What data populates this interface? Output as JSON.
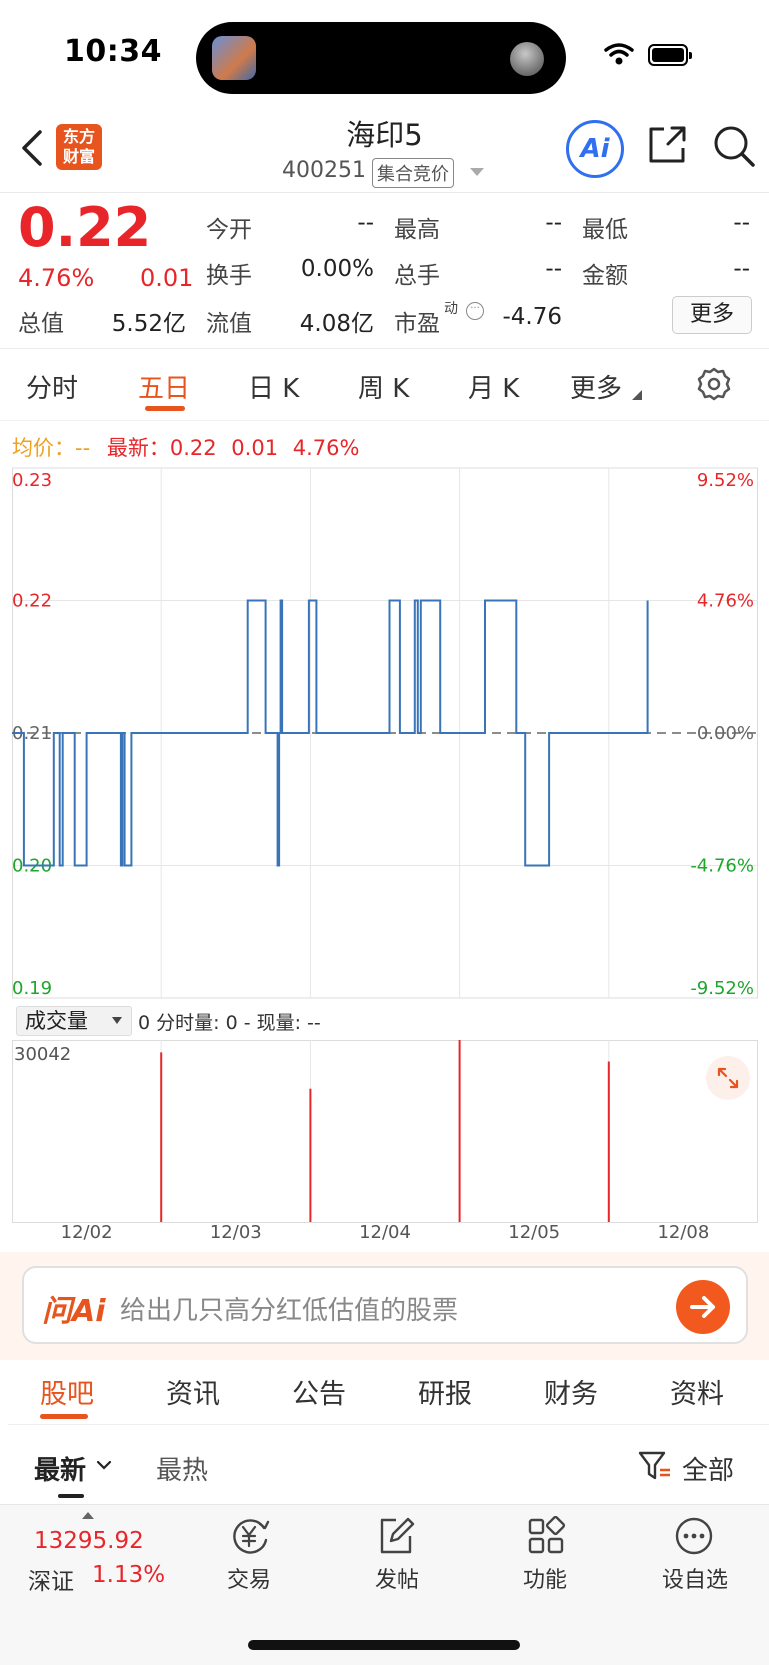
{
  "status_bar": {
    "time": "10:34"
  },
  "header": {
    "logo_text_1": "东方",
    "logo_text_2": "财富",
    "stock_name": "海印5",
    "stock_code": "400251",
    "session_badge": "集合竞价",
    "ai_label": "Ai"
  },
  "quote": {
    "price": "0.22",
    "change_pct": "4.76%",
    "change": "0.01",
    "fields": {
      "open_label": "今开",
      "open_value": "--",
      "high_label": "最高",
      "high_value": "--",
      "low_label": "最低",
      "low_value": "--",
      "turnover_label": "换手",
      "turnover_value": "0.00%",
      "volume_label": "总手",
      "volume_value": "--",
      "amount_label": "金额",
      "amount_value": "--",
      "total_cap_label": "总值",
      "total_cap_value": "5.52亿",
      "float_cap_label": "流值",
      "float_cap_value": "4.08亿",
      "pe_label": "市盈",
      "pe_sup": "动",
      "pe_value": "-4.76"
    },
    "more_button": "更多"
  },
  "tabs": [
    "分时",
    "五日",
    "日 K",
    "周 K",
    "月 K",
    "更多"
  ],
  "active_tab": "五日",
  "legend": {
    "avg_label": "均价：",
    "avg_value": "--",
    "latest_label": "最新：",
    "latest_price": "0.22",
    "latest_change": "0.01",
    "latest_pct": "4.76%"
  },
  "chart_data": [
    {
      "type": "line",
      "title": "",
      "x_categories": [
        "12/02",
        "12/03",
        "12/04",
        "12/05",
        "12/08"
      ],
      "y_ticks": [
        "0.23",
        "0.22",
        "0.21",
        "0.20",
        "0.19"
      ],
      "y_right_ticks": [
        "9.52%",
        "4.76%",
        "0.00%",
        "-4.76%",
        "-9.52%"
      ],
      "ylim": [
        0.19,
        0.23
      ],
      "reference_line": 0.21,
      "series": [
        {
          "x": [
            0.0,
            0.08,
            0.08,
            0.28,
            0.28,
            0.32,
            0.32,
            0.34,
            0.34,
            0.345,
            0.345,
            0.42,
            0.42,
            0.5,
            0.5,
            0.73,
            0.73,
            0.74,
            0.74,
            0.755,
            0.755,
            0.8,
            0.8,
            1.0,
            1.0,
            1.07,
            1.07,
            1.27,
            1.27,
            1.29,
            1.29,
            1.3,
            1.3,
            1.31,
            1.31,
            1.35,
            1.35,
            1.58,
            1.58,
            1.7,
            1.7,
            1.78,
            1.78,
            1.79,
            1.79,
            1.8,
            1.8,
            1.81,
            1.81,
            1.99,
            1.99,
            2.04,
            2.04,
            2.53,
            2.53,
            2.6,
            2.6,
            2.7,
            2.7,
            2.72,
            2.72,
            2.74,
            2.74,
            2.87,
            2.87,
            3.17,
            3.17,
            3.38,
            3.38,
            3.44,
            3.44,
            3.6,
            3.6,
            3.67,
            3.67,
            3.86,
            3.86,
            4.0,
            4.0,
            4.26,
            4.26
          ],
          "y": [
            0.21,
            0.21,
            0.2,
            0.2,
            0.21,
            0.21,
            0.2,
            0.2,
            0.21,
            0.21,
            0.21,
            0.21,
            0.2,
            0.2,
            0.21,
            0.21,
            0.2,
            0.2,
            0.21,
            0.21,
            0.2,
            0.2,
            0.21,
            0.21,
            0.21,
            0.21,
            0.21,
            0.21,
            0.21,
            0.21,
            0.21,
            0.21,
            0.21,
            0.21,
            0.21,
            0.21,
            0.21,
            0.21,
            0.22,
            0.22,
            0.21,
            0.21,
            0.2,
            0.2,
            0.21,
            0.21,
            0.22,
            0.22,
            0.21,
            0.21,
            0.22,
            0.22,
            0.21,
            0.21,
            0.22,
            0.22,
            0.21,
            0.21,
            0.22,
            0.22,
            0.21,
            0.21,
            0.22,
            0.22,
            0.21,
            0.21,
            0.22,
            0.22,
            0.21,
            0.21,
            0.2,
            0.2,
            0.21,
            0.21,
            0.21,
            0.21,
            0.21,
            0.21,
            0.21,
            0.21,
            0.22
          ]
        }
      ]
    },
    {
      "type": "bar",
      "title": "",
      "ymax_label": "30042",
      "ylim": [
        0,
        30042
      ],
      "x": [
        1.0,
        2.0,
        3.0,
        4.0
      ],
      "values": [
        28000,
        22000,
        30042,
        26500
      ]
    }
  ],
  "volume_panel": {
    "selector_label": "成交量",
    "info": "0 分时量: 0 - 现量: --"
  },
  "ask_ai": {
    "logo": "问Ai",
    "prompt": "给出几只高分红低估值的股票"
  },
  "bottom_tabs": [
    "股吧",
    "资讯",
    "公告",
    "研报",
    "财务",
    "资料"
  ],
  "sort": {
    "latest": "最新",
    "hot": "最热",
    "filter": "全部"
  },
  "bottom_bar": {
    "index_value": "13295.92",
    "index_name": "深证",
    "index_pct": "1.13%",
    "trade": "交易",
    "post": "发帖",
    "features": "功能",
    "watchlist": "设自选"
  },
  "colors": {
    "up": "#e8262a",
    "down": "#1ea62a",
    "accent": "#e8541e",
    "line": "#3a74b8",
    "ai_blue": "#2f6ff0"
  }
}
